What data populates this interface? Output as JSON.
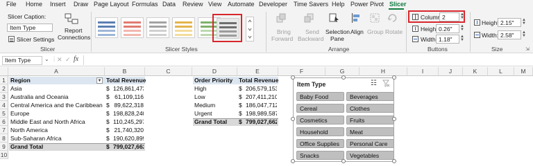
{
  "menu": [
    "File",
    "Home",
    "Insert",
    "Draw",
    "Page Layout",
    "Formulas",
    "Data",
    "Review",
    "View",
    "Automate",
    "Developer",
    "Time Savers",
    "Help",
    "Power Pivot",
    "Slicer"
  ],
  "ribbon": {
    "slicer_group": {
      "caption_label": "Slicer Caption:",
      "caption_value": "Item Type",
      "settings_label": "Slicer Settings",
      "connections_label_1": "Report",
      "connections_label_2": "Connections",
      "group_label": "Slicer"
    },
    "styles_group": {
      "group_label": "Slicer Styles"
    },
    "arrange_group": {
      "bring_forward_1": "Bring",
      "bring_forward_2": "Forward",
      "send_backward_1": "Send",
      "send_backward_2": "Backward",
      "selection_pane_1": "Selection",
      "selection_pane_2": "Pane",
      "align": "Align",
      "group": "Group",
      "rotate": "Rotate",
      "group_label": "Arrange"
    },
    "buttons_group": {
      "columns_label": "Columns:",
      "columns_value": "2",
      "height_label": "Height:",
      "height_value": "0.26\"",
      "width_label": "Width:",
      "width_value": "1.18\"",
      "group_label": "Buttons"
    },
    "size_group": {
      "height_label": "Height:",
      "height_value": "2.15\"",
      "width_label": "Width:",
      "width_value": "2.58\"",
      "group_label": "Size"
    }
  },
  "formula_bar": {
    "name_box": "Item Type",
    "fx": "fx",
    "formula": ""
  },
  "columns": [
    "A",
    "B",
    "C",
    "D",
    "E",
    "F",
    "G",
    "H",
    "I",
    "J",
    "K",
    "L",
    "M"
  ],
  "rows": [
    "1",
    "2",
    "3",
    "4",
    "5",
    "6",
    "7",
    "8",
    "9",
    "10"
  ],
  "pivot1": {
    "header_region": "Region",
    "header_total": "Total Revenue",
    "rows": [
      {
        "region": "Asia",
        "cur": "$",
        "value": "126,861,473"
      },
      {
        "region": "Australia and Oceania",
        "cur": "$",
        "value": "61,109,116"
      },
      {
        "region": "Central America and the Caribbean",
        "cur": "$",
        "value": "89,622,318"
      },
      {
        "region": "Europe",
        "cur": "$",
        "value": "198,828,240"
      },
      {
        "region": "Middle East and North Africa",
        "cur": "$",
        "value": "110,245,297"
      },
      {
        "region": "North America",
        "cur": "$",
        "value": "21,740,320"
      },
      {
        "region": "Sub-Saharan Africa",
        "cur": "$",
        "value": "190,620,899"
      }
    ],
    "grand_label": "Grand Total",
    "grand_cur": "$",
    "grand_value": "799,027,662"
  },
  "pivot2": {
    "header_priority": "Order Priority",
    "header_total": "Total Revenue",
    "rows": [
      {
        "priority": "High",
        "cur": "$",
        "value": "206,579,153"
      },
      {
        "priority": "Low",
        "cur": "$",
        "value": "207,411,210"
      },
      {
        "priority": "Medium",
        "cur": "$",
        "value": "186,047,712"
      },
      {
        "priority": "Urgent",
        "cur": "$",
        "value": "198,989,587"
      }
    ],
    "grand_label": "Grand Total",
    "grand_cur": "$",
    "grand_value": "799,027,662"
  },
  "slicer": {
    "title": "Item Type",
    "items": [
      "Baby Food",
      "Beverages",
      "Cereal",
      "Clothes",
      "Cosmetics",
      "Fruits",
      "Household",
      "Meat",
      "Office Supplies",
      "Personal Care",
      "Snacks",
      "Vegetables"
    ]
  },
  "colors": {
    "accent": "#107c41",
    "highlight": "#d9262b",
    "slicer_item": "#bfbfbf"
  }
}
